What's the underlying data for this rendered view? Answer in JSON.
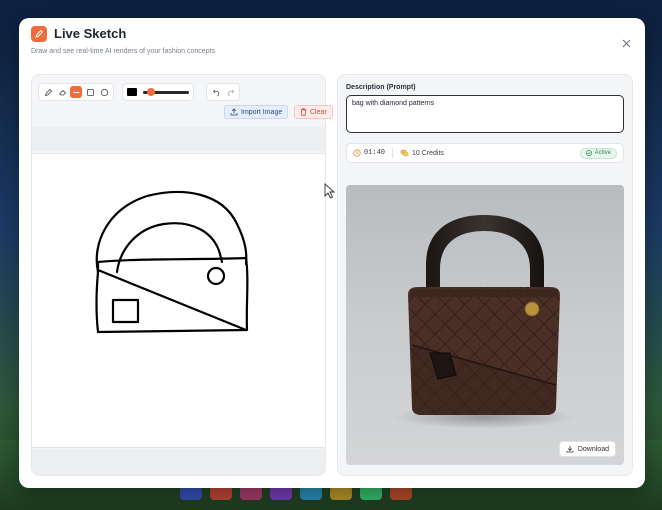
{
  "app": {
    "title": "Live Sketch",
    "subtitle": "Draw and see real-time AI renders of your fashion concepts",
    "icon": "pencil-icon",
    "accent_color": "#f26b3a"
  },
  "toolbar": {
    "tools": [
      "pencil-icon",
      "eraser-icon",
      "line-icon",
      "rectangle-icon",
      "circle-icon"
    ],
    "active_tool": "line-icon",
    "stroke_color": "#000000",
    "brush_size_fraction": 0.1,
    "undo_icon": "undo-icon",
    "redo_icon": "redo-icon",
    "import_label": "Import Image",
    "clear_label": "Clear"
  },
  "prompt": {
    "label": "Description (Prompt)",
    "value": "bag with diamond patterns"
  },
  "status": {
    "timer": "01:40",
    "credits": "10 Credits",
    "state": "Active"
  },
  "result": {
    "download_label": "Download"
  }
}
